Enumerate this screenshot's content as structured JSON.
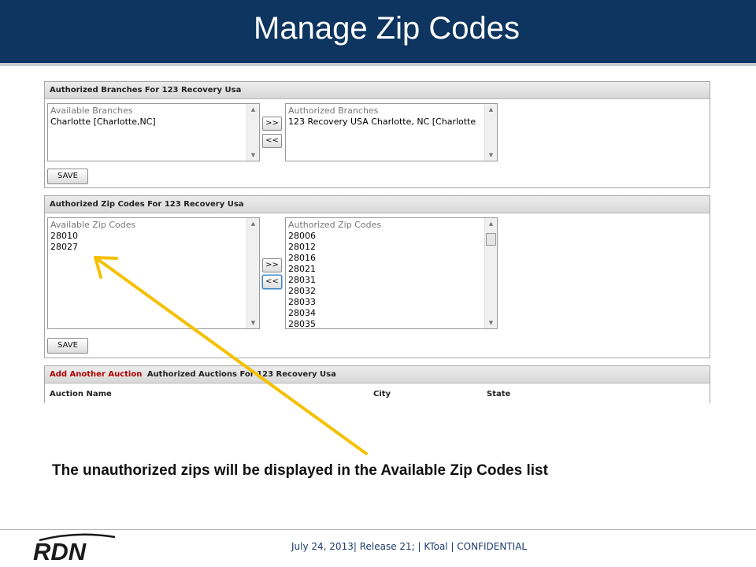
{
  "slide": {
    "title": "Manage Zip Codes",
    "caption": "The unauthorized zips will be displayed in the Available Zip Codes list",
    "footer": "July 24, 2013| Release 21; | KToal | CONFIDENTIAL",
    "logo_text": "RDN"
  },
  "branches_panel": {
    "header": "Authorized Branches For 123 Recovery Usa",
    "available_caption": "Available Branches",
    "available_items": [
      "Charlotte [Charlotte,NC]"
    ],
    "authorized_caption": "Authorized Branches",
    "authorized_items": [
      "123 Recovery USA Charlotte, NC [Charlotte"
    ],
    "add_label": ">>",
    "remove_label": "<<",
    "save_label": "SAVE"
  },
  "zips_panel": {
    "header": "Authorized Zip Codes For 123 Recovery Usa",
    "available_caption": "Available Zip Codes",
    "available_items": [
      "28010",
      "28027"
    ],
    "authorized_caption": "Authorized Zip Codes",
    "authorized_items": [
      "28006",
      "28012",
      "28016",
      "28021",
      "28031",
      "28032",
      "28033",
      "28034",
      "28035"
    ],
    "add_label": ">>",
    "remove_label": "<<",
    "save_label": "SAVE"
  },
  "auctions_panel": {
    "add_link": "Add Another Auction",
    "header": "Authorized Auctions For 123 Recovery Usa",
    "columns": [
      "Auction Name",
      "City",
      "State"
    ]
  },
  "colors": {
    "title_bar": "#0d3560",
    "arrow": "#f5c000",
    "link": "#b00000"
  },
  "icons": {
    "scroll_up": "triangle-up",
    "scroll_down": "triangle-down",
    "annotation": "arrow-pointer"
  }
}
